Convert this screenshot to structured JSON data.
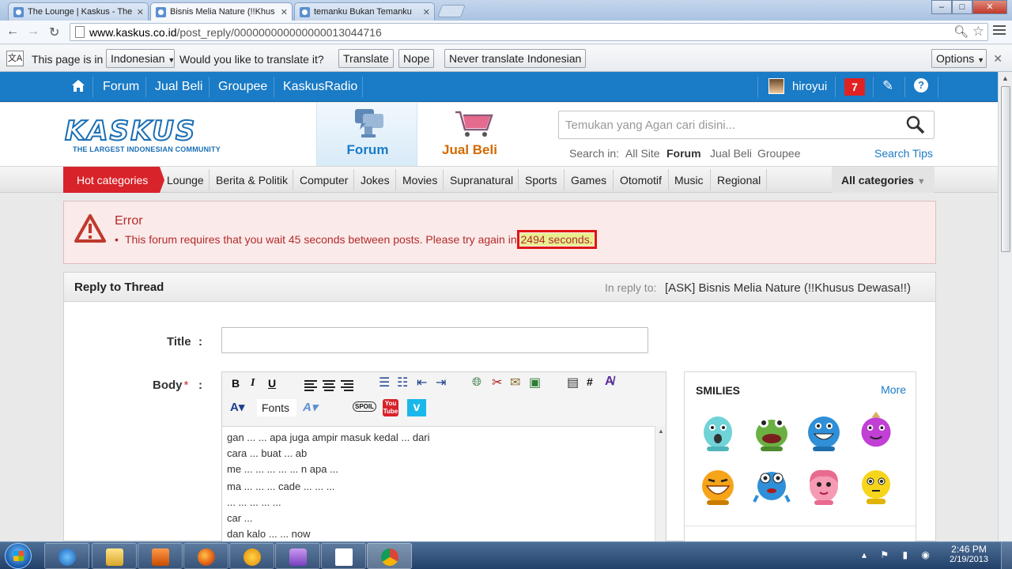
{
  "browser": {
    "tabs": [
      {
        "title": "The Lounge | Kaskus - The"
      },
      {
        "title": "Bisnis Melia Nature (!!Khus"
      },
      {
        "title": "temanku Bukan Temanku"
      }
    ],
    "url_domain": "www.kaskus.co.id",
    "url_path": "/post_reply/000000000000000013044716"
  },
  "translate_bar": {
    "prefix": "This page is in",
    "language": "Indonesian",
    "question": "Would you like to translate it?",
    "translate": "Translate",
    "nope": "Nope",
    "never": "Never translate Indonesian",
    "options": "Options"
  },
  "topnav": {
    "items": [
      "Forum",
      "Jual Beli",
      "Groupee",
      "KaskusRadio"
    ],
    "username": "hiroyui",
    "notification_count": "7"
  },
  "header": {
    "logo_text": "KASKUS",
    "logo_tagline": "THE LARGEST INDONESIAN COMMUNITY",
    "forum_label": "Forum",
    "jualbeli_label": "Jual Beli",
    "search_placeholder": "Temukan yang Agan cari disini...",
    "search_in_label": "Search in:",
    "search_scopes": [
      "All Site",
      "Forum",
      "Jual Beli",
      "Groupee"
    ],
    "search_tips": "Search Tips"
  },
  "categories": {
    "hot": "Hot categories",
    "items": [
      "Lounge",
      "Berita & Politik",
      "Computer",
      "Jokes",
      "Movies",
      "Supranatural",
      "Sports",
      "Games",
      "Otomotif",
      "Music",
      "Regional"
    ],
    "all": "All categories"
  },
  "error": {
    "title": "Error",
    "message": "This forum requires that you wait 45 seconds between posts. Please try again in",
    "seconds": "2494 seconds."
  },
  "reply": {
    "heading": "Reply to Thread",
    "in_reply_to": "In reply to:",
    "thread_title": "[ASK] Bisnis Melia Nature (!!Khusus Dewasa!!)",
    "title_label": "Title",
    "body_label": "Body",
    "colon": ":",
    "required_mark": "*",
    "fonts_label": "Fonts",
    "body_lines": [
      "gan ... ... apa juga ampir masuk kedal ... dari",
      "cara ... buat ... ab",
      "me ... ... ... ... ... n apa ...",
      "ma ... ... ... cade ... ... ...",
      "... ... ... ... ...",
      "car ...",
      "dan kalo ... ... now"
    ]
  },
  "smilies": {
    "heading": "SMILIES",
    "more": "More"
  },
  "taskbar": {
    "time": "2:46 PM",
    "date": "2/19/2013"
  }
}
